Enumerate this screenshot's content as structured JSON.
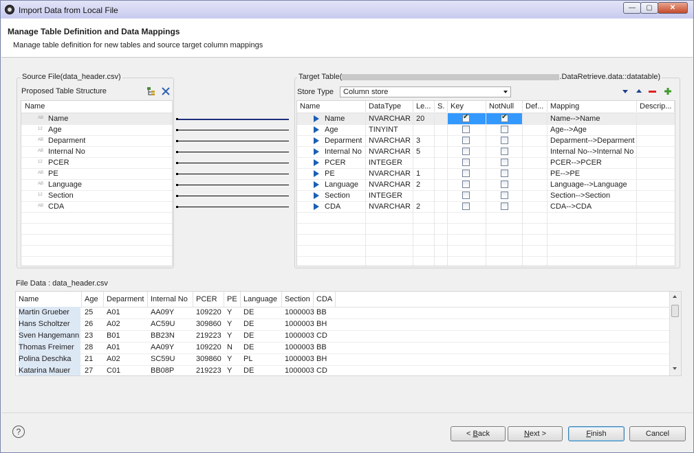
{
  "window": {
    "title": "Import Data from Local File",
    "min": "—",
    "max": "▢",
    "close": "✕"
  },
  "header": {
    "title": "Manage Table Definition and Data Mappings",
    "subtitle": "Manage table definition for new tables and source target column mappings"
  },
  "source": {
    "group_label": "Source File(data_header.csv)",
    "proposed_label": "Proposed Table Structure",
    "col_name": "Name",
    "fields": [
      {
        "name": "Name",
        "type": "AB"
      },
      {
        "name": "Age",
        "type": "12"
      },
      {
        "name": "Deparment",
        "type": "AB"
      },
      {
        "name": "Internal No",
        "type": "AB"
      },
      {
        "name": "PCER",
        "type": "12"
      },
      {
        "name": "PE",
        "type": "AB"
      },
      {
        "name": "Language",
        "type": "AB"
      },
      {
        "name": "Section",
        "type": "12"
      },
      {
        "name": "CDA",
        "type": "AB"
      }
    ]
  },
  "target": {
    "group_label_prefix": "Target Table(",
    "group_label_suffix": ".DataRetrieve.data::datatable)",
    "store_type_label": "Store Type",
    "store_type_value": "Column store",
    "columns": [
      "Name",
      "DataType",
      "Le...",
      "S.",
      "Key",
      "NotNull",
      "Def...",
      "Mapping",
      "Descrip..."
    ],
    "rows": [
      {
        "name": "Name",
        "type": "NVARCHAR",
        "len": "20",
        "key": true,
        "notnull": true,
        "mapping": "Name-->Name"
      },
      {
        "name": "Age",
        "type": "TINYINT",
        "len": "",
        "key": false,
        "notnull": false,
        "mapping": "Age-->Age"
      },
      {
        "name": "Deparment",
        "type": "NVARCHAR",
        "len": "3",
        "key": false,
        "notnull": false,
        "mapping": "Deparment-->Deparment"
      },
      {
        "name": "Internal No",
        "type": "NVARCHAR",
        "len": "5",
        "key": false,
        "notnull": false,
        "mapping": "Internal No-->Internal No"
      },
      {
        "name": "PCER",
        "type": "INTEGER",
        "len": "",
        "key": false,
        "notnull": false,
        "mapping": "PCER-->PCER"
      },
      {
        "name": "PE",
        "type": "NVARCHAR",
        "len": "1",
        "key": false,
        "notnull": false,
        "mapping": "PE-->PE"
      },
      {
        "name": "Language",
        "type": "NVARCHAR",
        "len": "2",
        "key": false,
        "notnull": false,
        "mapping": "Language-->Language"
      },
      {
        "name": "Section",
        "type": "INTEGER",
        "len": "",
        "key": false,
        "notnull": false,
        "mapping": "Section-->Section"
      },
      {
        "name": "CDA",
        "type": "NVARCHAR",
        "len": "2",
        "key": false,
        "notnull": false,
        "mapping": "CDA-->CDA"
      }
    ]
  },
  "file_data": {
    "label": "File Data : data_header.csv",
    "columns": [
      "Name",
      "Age",
      "Deparment",
      "Internal No",
      "PCER",
      "PE",
      "Language",
      "Section",
      "CDA"
    ],
    "rows": [
      [
        "Martin Grueber",
        "25",
        "A01",
        "AA09Y",
        "109220",
        "Y",
        "DE",
        "1000003",
        "BB"
      ],
      [
        "Hans Scholtzer",
        "26",
        "A02",
        "AC59U",
        "309860",
        "Y",
        "DE",
        "1000003",
        "BH"
      ],
      [
        "Sven Hangemann",
        "23",
        "B01",
        "BB23N",
        "219223",
        "Y",
        "DE",
        "1000003",
        "CD"
      ],
      [
        "Thomas Freimer",
        "28",
        "A01",
        "AA09Y",
        "109220",
        "N",
        "DE",
        "1000003",
        "BB"
      ],
      [
        "Polina Deschka",
        "21",
        "A02",
        "SC59U",
        "309860",
        "Y",
        "PL",
        "1000003",
        "BH"
      ],
      [
        "Katarina Mauer",
        "27",
        "C01",
        "BB08P",
        "219223",
        "Y",
        "DE",
        "1000003",
        "CD"
      ]
    ]
  },
  "buttons": {
    "help": "?",
    "back": "< Back",
    "next": "Next >",
    "finish": "Finish",
    "cancel": "Cancel"
  }
}
